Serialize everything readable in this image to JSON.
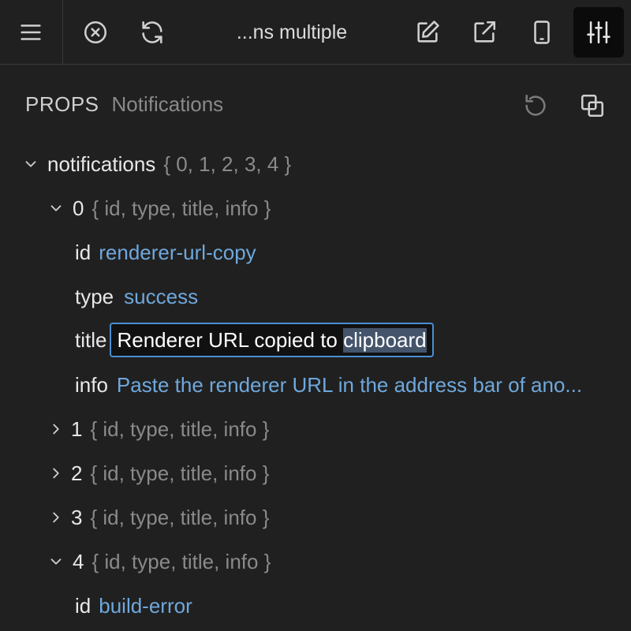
{
  "toolbar": {
    "title": "...ns multiple",
    "icons": [
      "menu-icon",
      "close-circle-icon",
      "refresh-icon",
      "edit-icon",
      "external-link-icon",
      "mobile-icon",
      "sliders-icon"
    ]
  },
  "props": {
    "label": "PROPS",
    "component": "Notifications"
  },
  "tree": {
    "root_key": "notifications",
    "root_summary": "{ 0, 1, 2, 3, 4 }",
    "item0": {
      "key": "0",
      "summary": "{ id, type, title, info }",
      "id_key": "id",
      "id_val": "renderer-url-copy",
      "type_key": "type",
      "type_val": "success",
      "title_key": "title",
      "title_val_a": "Renderer URL copied to ",
      "title_val_b": "clipboard",
      "info_key": "info",
      "info_val": "Paste the renderer URL in the address bar of ano..."
    },
    "item1": {
      "key": "1",
      "summary": "{ id, type, title, info }"
    },
    "item2": {
      "key": "2",
      "summary": "{ id, type, title, info }"
    },
    "item3": {
      "key": "3",
      "summary": "{ id, type, title, info }"
    },
    "item4": {
      "key": "4",
      "summary": "{ id, type, title, info }",
      "id_key": "id",
      "id_val": "build-error"
    }
  },
  "colors": {
    "background": "#202020",
    "value": "#6fa8dc",
    "muted": "#8a8a8a",
    "focus": "#4a8fd1"
  }
}
